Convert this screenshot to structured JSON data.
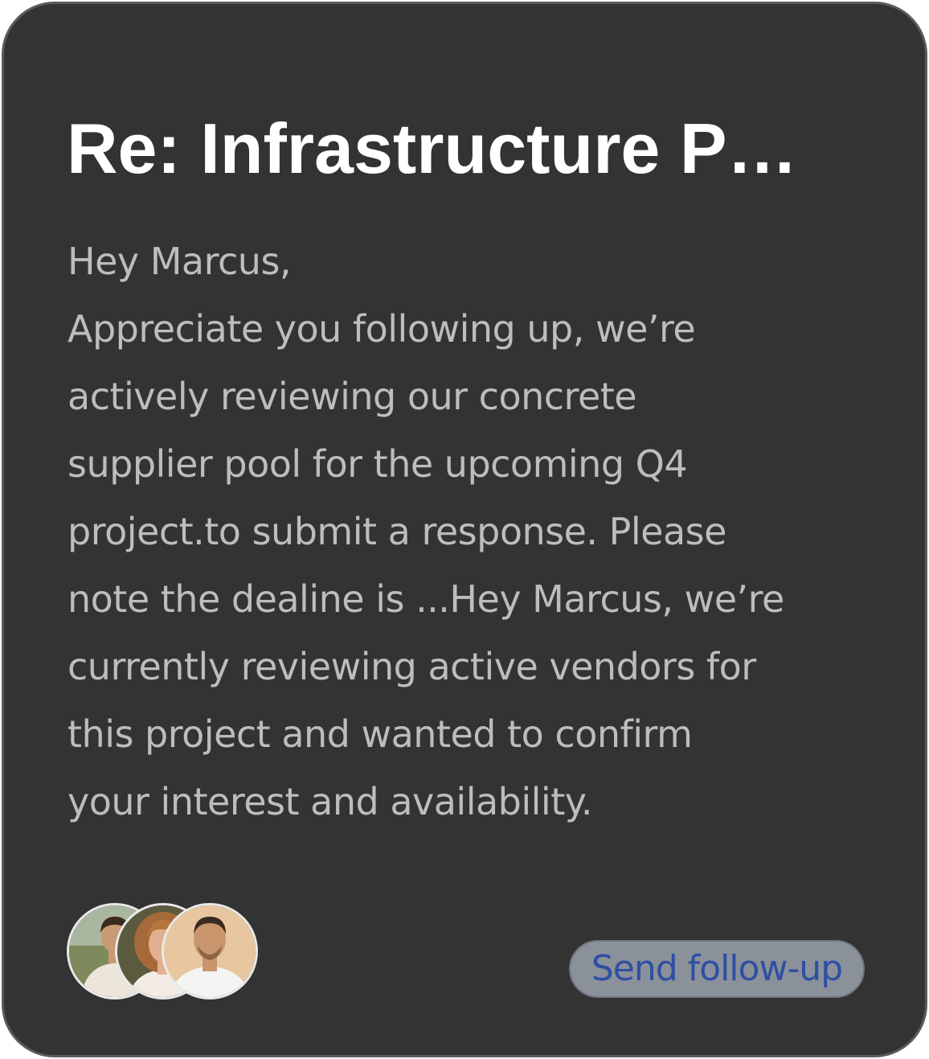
{
  "card": {
    "title": "Re: Infrastructure P…",
    "body_lines": [
      "Hey Marcus,",
      "Appreciate you following up, we’re",
      "actively reviewing our concrete",
      "supplier pool for the upcoming Q4",
      "project.to submit a response. Please",
      "note the dealine is ...Hey Marcus, we’re",
      "currently reviewing active vendors for",
      "this project and wanted to confirm",
      "your interest and availability."
    ],
    "avatars": [
      {
        "name": "participant-1",
        "bg": "#7e8a5c",
        "skin": "#c89a74",
        "shirt": "#ece6da",
        "hair": "#3a2a1e"
      },
      {
        "name": "participant-2",
        "bg": "#5b5a3e",
        "skin": "#e2b090",
        "shirt": "#f2ece4",
        "hair": "#a66a3a"
      },
      {
        "name": "participant-3",
        "bg": "#e8c7a0",
        "skin": "#c9956c",
        "shirt": "#f4f4f2",
        "hair": "#3b2a20"
      }
    ],
    "follow_up_button": "Send follow-up"
  },
  "colors": {
    "card_bg": "#333333",
    "card_border": "#5b5c58",
    "title": "#ffffff",
    "body_text": "#bdbdbd",
    "button_bg": "#8a919a",
    "button_text": "#2f4fa3"
  }
}
